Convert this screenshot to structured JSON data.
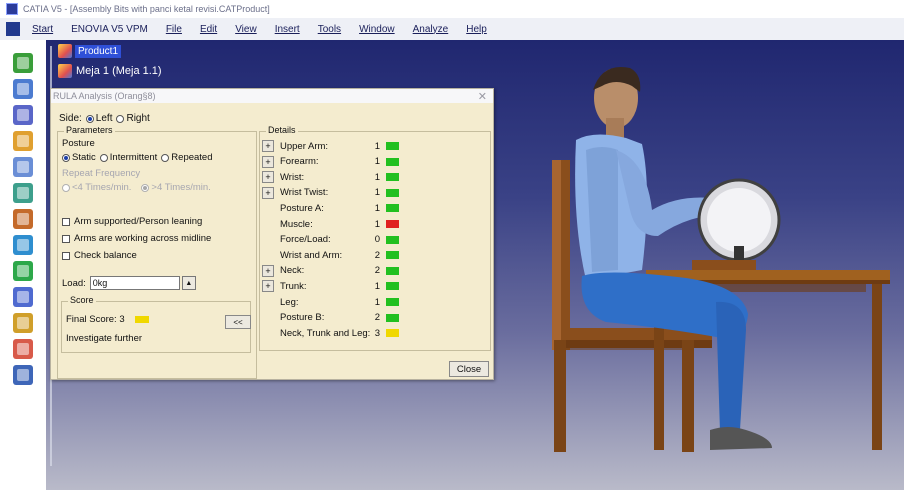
{
  "window": {
    "title": "CATIA V5 - [Assembly Bits with panci ketal revisi.CATProduct]"
  },
  "menu": [
    "Start",
    "ENOVIA V5 VPM",
    "File",
    "Edit",
    "View",
    "Insert",
    "Tools",
    "Window",
    "Analyze",
    "Help"
  ],
  "tree": {
    "root": "Product1",
    "child": "Meja 1 (Meja 1.1)"
  },
  "dialog": {
    "title": "RULA Analysis (Orang§8)",
    "close_icon": "close-icon",
    "side_label": "Side:",
    "side_left": "Left",
    "side_right": "Right",
    "parameters_caption": "Parameters",
    "posture_label": "Posture",
    "posture_static": "Static",
    "posture_intermittent": "Intermittent",
    "posture_repeated": "Repeated",
    "repeat_label": "Repeat Frequency",
    "repeat_lt4": "<4 Times/min.",
    "repeat_gt4": ">4 Times/min.",
    "arm_supported": "Arm supported/Person leaning",
    "arms_across": "Arms are working across midline",
    "check_balance": "Check balance",
    "load_label": "Load:",
    "load_value": "0kg",
    "score_caption": "Score",
    "final_score": "Final Score: 3",
    "final_color": "#f0d800",
    "investigate": "Investigate further",
    "expand_button": "<<",
    "details_caption": "Details",
    "close_button": "Close",
    "details": [
      {
        "label": "Upper Arm:",
        "value": "1",
        "color": "#22c020",
        "expand": true
      },
      {
        "label": "Forearm:",
        "value": "1",
        "color": "#22c020",
        "expand": true
      },
      {
        "label": "Wrist:",
        "value": "1",
        "color": "#22c020",
        "expand": true
      },
      {
        "label": "Wrist Twist:",
        "value": "1",
        "color": "#22c020",
        "expand": true
      },
      {
        "label": "Posture A:",
        "value": "1",
        "color": "#22c020",
        "expand": false
      },
      {
        "label": "Muscle:",
        "value": "1",
        "color": "#e02020",
        "expand": false
      },
      {
        "label": "Force/Load:",
        "value": "0",
        "color": "#22c020",
        "expand": false
      },
      {
        "label": "Wrist and Arm:",
        "value": "2",
        "color": "#22c020",
        "expand": false
      },
      {
        "label": "Neck:",
        "value": "2",
        "color": "#22c020",
        "expand": true
      },
      {
        "label": "Trunk:",
        "value": "1",
        "color": "#22c020",
        "expand": true
      },
      {
        "label": "Leg:",
        "value": "1",
        "color": "#22c020",
        "expand": false
      },
      {
        "label": "Posture B:",
        "value": "2",
        "color": "#22c020",
        "expand": false
      },
      {
        "label": "Neck, Trunk and Leg:",
        "value": "3",
        "color": "#f0d800",
        "expand": false
      }
    ]
  },
  "toolbar_icons": [
    "assembly-icon",
    "move-icon",
    "snap-icon",
    "constraint-icon",
    "analysis-icon",
    "catalog-icon",
    "product-icon",
    "axis-icon",
    "manikin-icon",
    "posture-icon",
    "measure-icon",
    "render-icon",
    "settings-icon"
  ],
  "colors": {
    "viewport_top": "#202770",
    "viewport_bottom": "#b9bac9",
    "dialog_bg": "#f4eccf",
    "wood": "#8a4e1c",
    "shirt": "#8fb3e8",
    "pants": "#2f6fc8"
  }
}
